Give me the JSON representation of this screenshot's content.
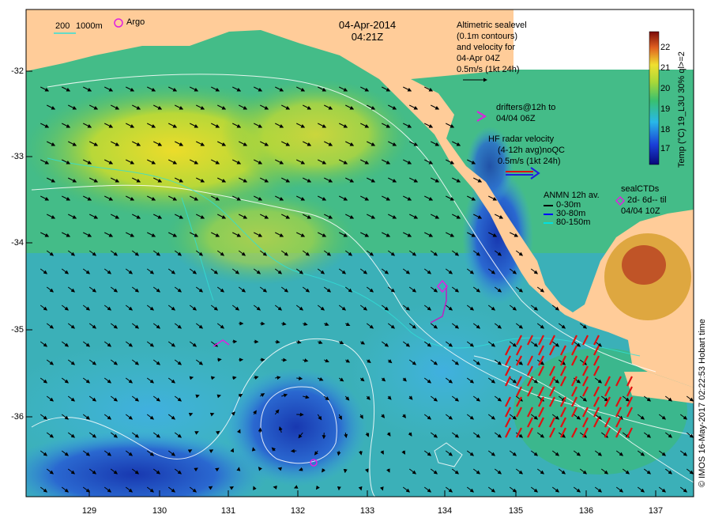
{
  "title": {
    "date": "04-Apr-2014",
    "time": "04:21Z"
  },
  "bathymetry_legend": {
    "d200": "200",
    "d1000": "1000m"
  },
  "argo_legend": "Argo",
  "altimetry_legend": [
    "Altimetric sealevel",
    "(0.1m contours)",
    "and velocity for",
    "04-Apr 04Z",
    "0.5m/s (1kt 24h)"
  ],
  "drifters_legend": [
    "drifters@12h to",
    "04/04 06Z"
  ],
  "hf_radar_legend": [
    "HF radar velocity",
    "(4-12h avg)noQC",
    "0.5m/s (1kt 24h)"
  ],
  "anmn_legend": {
    "title": "ANMN 12h av.",
    "items": [
      {
        "label": "0-30m",
        "color": "#000000"
      },
      {
        "label": "30-80m",
        "color": "#0000ff"
      },
      {
        "label": "80-150m",
        "color": "#00e0e0"
      }
    ]
  },
  "sealctd_legend": [
    "sealCTDs",
    "2d- 6d-- til",
    "04/04 10Z"
  ],
  "colorbar": {
    "label": "Temp (°C) 19_L3U 30% ql>=2",
    "ticks": [
      "22",
      "21",
      "20",
      "19",
      "18",
      "17"
    ],
    "range": [
      16.3,
      22.8
    ]
  },
  "credit": "© IMOS 16-May-2017 02:22:53 Hobart time",
  "axes": {
    "lon_ticks": [
      "129",
      "130",
      "131",
      "132",
      "133",
      "134",
      "135",
      "136",
      "137"
    ],
    "lat_ticks": [
      "-32",
      "-33",
      "-34",
      "-35",
      "-36"
    ],
    "lon_range": [
      128.2,
      137.5
    ],
    "lat_range": [
      -31.2,
      -36.9
    ]
  },
  "colors": {
    "land": "#ffcc99",
    "sst_cold": "#1a2aa8",
    "sst_cool": "#2fa0e0",
    "sst_mid": "#3cc080",
    "sst_warm": "#f0e030",
    "sst_hot": "#c83020",
    "radar_arrow": "#e01010",
    "accent_magenta": "#e020e0"
  }
}
